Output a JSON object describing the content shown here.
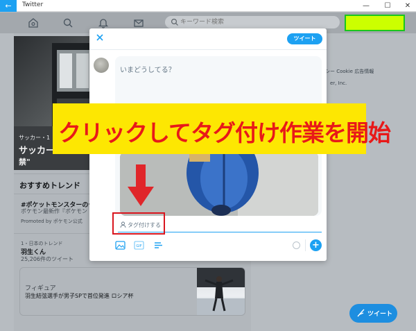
{
  "window": {
    "title": "Twitter",
    "back_icon": "back-arrow-icon",
    "controls": [
      "—",
      "☐",
      "✕"
    ]
  },
  "nav": {
    "icons": [
      "home-icon",
      "search-icon",
      "bell-icon",
      "mail-icon"
    ],
    "search_placeholder": "キーワード検索"
  },
  "timeline": {
    "hero_tag": "サッカー・1",
    "hero_title": "サッカー",
    "hero_subtitle": "禁\"",
    "trends_title": "おすすめトレンド",
    "trends": [
      {
        "title": "#ポケットモンスターのセ",
        "subtitle": "ポケモン最新作『ポケモン",
        "promoted": "Promoted by ポケモン公式"
      },
      {
        "rank": "1・日本のトレンド",
        "name": "羽生くん",
        "count": "25,206件のツイート"
      }
    ],
    "news": {
      "category": "フィギュア",
      "headline": "羽生結弦選手が男子SPで首位発進 ロシア杯"
    }
  },
  "sidebar": {
    "links": "リシー Cookie 広告情報",
    "links2": "er, Inc."
  },
  "compose_modal": {
    "tweet_button": "ツイート",
    "placeholder": "いまどうしてる？",
    "tag_label": "タグ付けする",
    "toolbar_icons": [
      "image-icon",
      "gif-icon",
      "poll-icon"
    ],
    "add_icon": "plus-icon"
  },
  "floating_button": {
    "label": "ツイート",
    "icon": "feather-icon"
  },
  "annotation": {
    "banner_text": "クリックしてタグ付け作業を開始",
    "banner_color": "#fde702",
    "text_color": "#e81919"
  },
  "colors": {
    "accent": "#1da1f2",
    "highlight": "#ccff00"
  }
}
